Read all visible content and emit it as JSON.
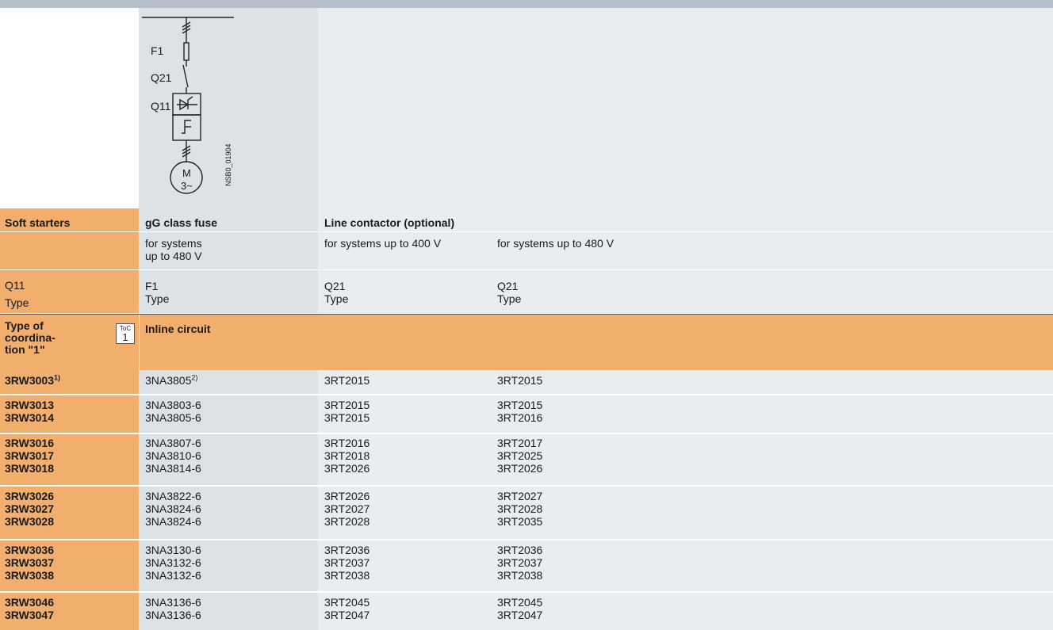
{
  "diagram": {
    "f1": "F1",
    "q21": "Q21",
    "q11": "Q11",
    "motor_m": "M",
    "motor_phase": "3~",
    "drawing_no": "NSB0_01904"
  },
  "header": {
    "soft_starters": "Soft starters",
    "fuse_title": "gG class fuse",
    "contactor_title": "Line contactor (optional)",
    "fuse_sub": "for systems\nup to 480 V",
    "contactor_sub_400": "for systems up to 400 V",
    "contactor_sub_480": "for systems up to 480 V",
    "q11": "Q11",
    "type": "Type",
    "f1": "F1",
    "q21": "Q21"
  },
  "section": {
    "coordination": "Type of\ncoordina-\ntion \"1\"",
    "toc_top": "ToC",
    "toc_num": "1",
    "title": "Inline circuit"
  },
  "rows": [
    {
      "starter": "3RW3003",
      "starter_sup": "1)",
      "fuse": "3NA3805",
      "fuse_sup": "2)",
      "q21_400": "3RT2015",
      "q21_480": "3RT2015"
    },
    {
      "starter": "3RW3013\n3RW3014",
      "fuse": "3NA3803-6\n3NA3805-6",
      "q21_400": "3RT2015\n3RT2015",
      "q21_480": "3RT2015\n3RT2016"
    },
    {
      "starter": "3RW3016\n3RW3017\n3RW3018",
      "fuse": "3NA3807-6\n3NA3810-6\n3NA3814-6",
      "q21_400": "3RT2016\n3RT2018\n3RT2026",
      "q21_480": "3RT2017\n3RT2025\n3RT2026"
    },
    {
      "starter": "3RW3026\n3RW3027\n3RW3028",
      "fuse": "3NA3822-6\n3NA3824-6\n3NA3824-6",
      "q21_400": "3RT2026\n3RT2027\n3RT2028",
      "q21_480": "3RT2027\n3RT2028\n3RT2035"
    },
    {
      "starter": "3RW3036\n3RW3037\n3RW3038",
      "fuse": "3NA3130-6\n3NA3132-6\n3NA3132-6",
      "q21_400": "3RT2036\n3RT2037\n3RT2038",
      "q21_480": "3RT2036\n3RT2037\n3RT2038"
    },
    {
      "starter": "3RW3046\n3RW3047",
      "fuse": "3NA3136-6\n3NA3136-6",
      "q21_400": "3RT2045\n3RT2047",
      "q21_480": "3RT2045\n3RT2047"
    }
  ]
}
